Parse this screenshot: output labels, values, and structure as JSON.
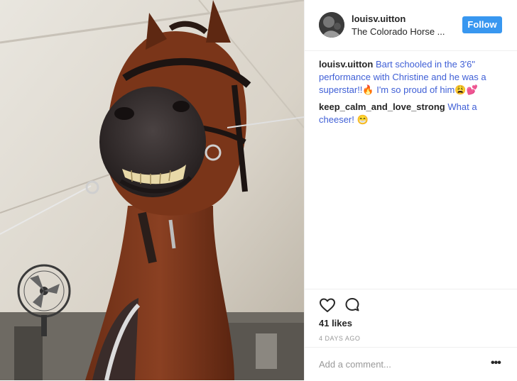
{
  "photo": {
    "icon": "horse-photo"
  },
  "header": {
    "username": "louisv.uitton",
    "location": "The Colorado Horse ...",
    "follow_label": "Follow"
  },
  "comments": [
    {
      "user": "louisv.uitton",
      "text": "Bart schooled in the 3'6\" performance with Christine and he was a superstar!!🔥 I'm so proud of him😩💕"
    },
    {
      "user": "keep_calm_and_love_strong",
      "text": "What a cheeser! 😁"
    }
  ],
  "actions": {
    "like_icon": "heart-icon",
    "comment_icon": "comment-bubble-icon",
    "likes": "41 likes",
    "timestamp": "4 DAYS AGO"
  },
  "comment_box": {
    "placeholder": "Add a comment...",
    "more": "•••"
  },
  "colors": {
    "follow": "#3897f0",
    "link": "#3f5fd6"
  }
}
